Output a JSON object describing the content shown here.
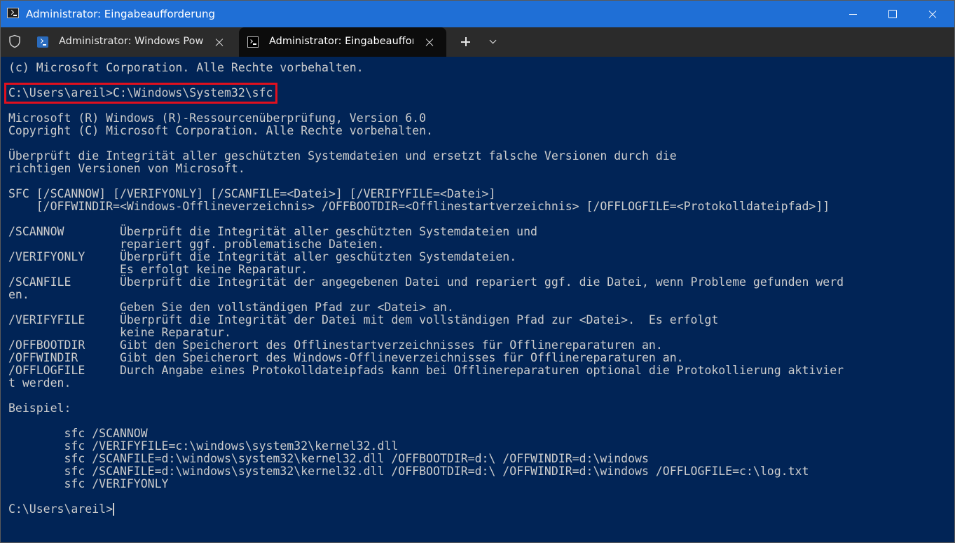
{
  "window": {
    "title": "Administrator: Eingabeaufforderung"
  },
  "tabs": [
    {
      "label": "Administrator: Windows PowerShell",
      "icon": "powershell-icon",
      "active": false
    },
    {
      "label": "Administrator: Eingabeaufforderung",
      "icon": "cmd-icon",
      "active": true
    }
  ],
  "colors": {
    "titlebar": "#1f6fd6",
    "tabbar": "#2b2b2b",
    "terminal_background": "#012456",
    "terminal_text": "#cccccc",
    "highlight_box": "#e0101e"
  },
  "terminal": {
    "lines": [
      "(c) Microsoft Corporation. Alle Rechte vorbehalten.",
      "",
      "C:\\Users\\areil>C:\\Windows\\System32\\sfc",
      "",
      "Microsoft (R) Windows (R)-Ressourcenüberprüfung, Version 6.0",
      "Copyright (C) Microsoft Corporation. Alle Rechte vorbehalten.",
      "",
      "Überprüft die Integrität aller geschützten Systemdateien und ersetzt falsche Versionen durch die",
      "richtigen Versionen von Microsoft.",
      "",
      "SFC [/SCANNOW] [/VERIFYONLY] [/SCANFILE=<Datei>] [/VERIFYFILE=<Datei>]",
      "    [/OFFWINDIR=<Windows-Offlineverzeichnis> /OFFBOOTDIR=<Offlinestartverzeichnis> [/OFFLOGFILE=<Protokolldateipfad>]]",
      "",
      "/SCANNOW        Überprüft die Integrität aller geschützten Systemdateien und",
      "                repariert ggf. problematische Dateien.",
      "/VERIFYONLY     Überprüft die Integrität aller geschützten Systemdateien.",
      "                Es erfolgt keine Reparatur.",
      "/SCANFILE       Überprüft die Integrität der angegebenen Datei und repariert ggf. die Datei, wenn Probleme gefunden werd",
      "en.",
      "                Geben Sie den vollständigen Pfad zur <Datei> an.",
      "/VERIFYFILE     Überprüft die Integrität der Datei mit dem vollständigen Pfad zur <Datei>.  Es erfolgt",
      "                keine Reparatur.",
      "/OFFBOOTDIR     Gibt den Speicherort des Offlinestartverzeichnisses für Offlinereparaturen an.",
      "/OFFWINDIR      Gibt den Speicherort des Windows-Offlineverzeichnisses für Offlinereparaturen an.",
      "/OFFLOGFILE     Durch Angabe eines Protokolldateipfads kann bei Offlinereparaturen optional die Protokollierung aktivier",
      "t werden.",
      "",
      "Beispiel:",
      "",
      "        sfc /SCANNOW",
      "        sfc /VERIFYFILE=c:\\windows\\system32\\kernel32.dll",
      "        sfc /SCANFILE=d:\\windows\\system32\\kernel32.dll /OFFBOOTDIR=d:\\ /OFFWINDIR=d:\\windows",
      "        sfc /SCANFILE=d:\\windows\\system32\\kernel32.dll /OFFBOOTDIR=d:\\ /OFFWINDIR=d:\\windows /OFFLOGFILE=c:\\log.txt",
      "        sfc /VERIFYONLY",
      ""
    ],
    "highlighted_line_index": 2,
    "prompt": "C:\\Users\\areil>"
  }
}
